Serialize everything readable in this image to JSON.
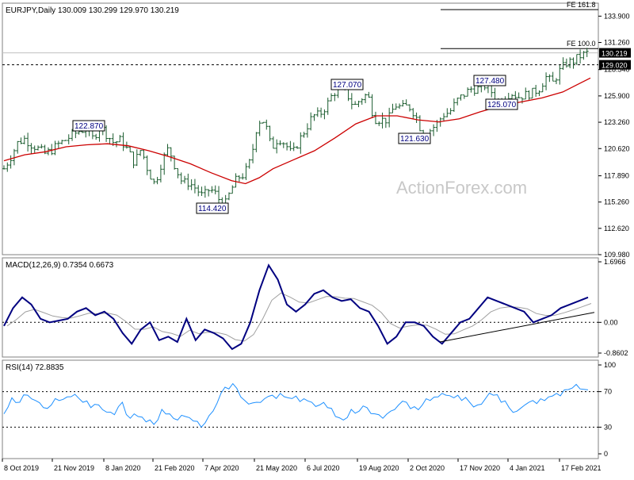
{
  "chart_data": [
    {
      "type": "candlestick",
      "title": "EURJPY,Daily  130.009 130.299 129.970 130.219",
      "ylim": [
        109.98,
        135.2
      ],
      "yticks": [
        "133.900",
        "131.260",
        "128.540",
        "125.900",
        "123.260",
        "120.620",
        "117.890",
        "115.260",
        "112.620",
        "109.980"
      ],
      "last_price": "130.219",
      "ref_level": "129.020",
      "fib_labels": [
        "FE 161.8",
        "FE 100.0"
      ],
      "fib_levels": [
        134.55,
        130.65
      ],
      "annotations": [
        "122.870",
        "114.420",
        "127.070",
        "121.630",
        "127.480",
        "125.070"
      ],
      "moving_average": "red",
      "watermark": "ActionForex.com",
      "price_path": [
        [
          0,
          118.6
        ],
        [
          2,
          119.8
        ],
        [
          4,
          121.2
        ],
        [
          6,
          121.6
        ],
        [
          8,
          121.0
        ],
        [
          10,
          120.6
        ],
        [
          12,
          120.1
        ],
        [
          14,
          120.5
        ],
        [
          16,
          121.1
        ],
        [
          18,
          121.5
        ],
        [
          20,
          122.0
        ],
        [
          22,
          122.4
        ],
        [
          24,
          122.6
        ],
        [
          26,
          121.6
        ],
        [
          28,
          122.9
        ],
        [
          30,
          122.0
        ],
        [
          32,
          121.2
        ],
        [
          34,
          121.5
        ],
        [
          36,
          120.5
        ],
        [
          38,
          119.2
        ],
        [
          40,
          120.6
        ],
        [
          42,
          118.4
        ],
        [
          44,
          117.0
        ],
        [
          46,
          119.3
        ],
        [
          48,
          120.7
        ],
        [
          50,
          118.7
        ],
        [
          52,
          117.2
        ],
        [
          54,
          117.2
        ],
        [
          56,
          116.6
        ],
        [
          58,
          115.8
        ],
        [
          60,
          116.6
        ],
        [
          62,
          116.0
        ],
        [
          64,
          114.6
        ],
        [
          66,
          116.3
        ],
        [
          68,
          117.7
        ],
        [
          70,
          118.0
        ],
        [
          72,
          119.5
        ],
        [
          74,
          123.4
        ],
        [
          76,
          123.4
        ],
        [
          78,
          120.6
        ],
        [
          80,
          121.7
        ],
        [
          82,
          121.1
        ],
        [
          84,
          120.0
        ],
        [
          86,
          121.4
        ],
        [
          88,
          122.6
        ],
        [
          90,
          123.9
        ],
        [
          92,
          124.0
        ],
        [
          94,
          124.9
        ],
        [
          96,
          126.2
        ],
        [
          98,
          126.6
        ],
        [
          100,
          126.1
        ],
        [
          102,
          124.8
        ],
        [
          104,
          125.6
        ],
        [
          106,
          126.1
        ],
        [
          108,
          123.6
        ],
        [
          110,
          123.5
        ],
        [
          112,
          123.5
        ],
        [
          114,
          125.0
        ],
        [
          116,
          124.7
        ],
        [
          118,
          124.9
        ],
        [
          120,
          124.0
        ],
        [
          122,
          122.1
        ],
        [
          124,
          122.4
        ],
        [
          126,
          123.0
        ],
        [
          128,
          124.0
        ],
        [
          130,
          124.3
        ],
        [
          132,
          125.4
        ],
        [
          134,
          126.0
        ],
        [
          136,
          126.6
        ],
        [
          138,
          126.6
        ],
        [
          140,
          127.0
        ],
        [
          142,
          126.4
        ],
        [
          144,
          125.3
        ],
        [
          146,
          125.9
        ],
        [
          148,
          126.2
        ],
        [
          150,
          125.8
        ],
        [
          152,
          126.0
        ],
        [
          154,
          126.2
        ],
        [
          156,
          126.6
        ],
        [
          158,
          127.8
        ],
        [
          160,
          127.2
        ],
        [
          162,
          128.4
        ],
        [
          164,
          129.2
        ],
        [
          166,
          129.4
        ],
        [
          168,
          129.9
        ],
        [
          170,
          130.2
        ]
      ],
      "ma_path": [
        [
          0,
          119.4
        ],
        [
          6,
          120.0
        ],
        [
          12,
          120.3
        ],
        [
          18,
          120.8
        ],
        [
          24,
          121.0
        ],
        [
          30,
          121.1
        ],
        [
          36,
          120.9
        ],
        [
          42,
          120.4
        ],
        [
          48,
          119.8
        ],
        [
          54,
          119.1
        ],
        [
          60,
          118.2
        ],
        [
          66,
          117.4
        ],
        [
          70,
          117.1
        ],
        [
          74,
          117.7
        ],
        [
          78,
          118.6
        ],
        [
          84,
          119.5
        ],
        [
          90,
          120.4
        ],
        [
          96,
          121.7
        ],
        [
          102,
          123.1
        ],
        [
          108,
          123.9
        ],
        [
          114,
          123.9
        ],
        [
          120,
          123.5
        ],
        [
          126,
          123.3
        ],
        [
          132,
          123.6
        ],
        [
          138,
          124.3
        ],
        [
          144,
          124.9
        ],
        [
          150,
          125.3
        ],
        [
          156,
          125.7
        ],
        [
          162,
          126.3
        ],
        [
          166,
          127.0
        ],
        [
          170,
          127.7
        ]
      ]
    },
    {
      "type": "line",
      "title": "MACD(12,26,9) 0.7354 0.6673",
      "ylim": [
        -0.8602,
        1.6966
      ],
      "yticks": [
        "1.6966",
        "0.00",
        "-0.8602"
      ],
      "series": [
        {
          "values": [
            -0.1,
            0.4,
            0.7,
            0.5,
            0.1,
            0.0,
            0.05,
            0.1,
            0.3,
            0.4,
            0.2,
            0.3,
            0.1,
            -0.3,
            -0.6,
            -0.2,
            0.0,
            -0.5,
            -0.4,
            -0.55,
            0.1,
            -0.5,
            -0.2,
            -0.3,
            -0.45,
            -0.75,
            -0.6,
            0.0,
            0.9,
            1.6,
            1.2,
            0.5,
            0.3,
            0.5,
            0.8,
            0.9,
            0.7,
            0.6,
            0.65,
            0.4,
            0.3,
            -0.1,
            -0.6,
            -0.4,
            0.0,
            0.0,
            -0.1,
            -0.4,
            -0.6,
            -0.3,
            0.0,
            0.1,
            0.4,
            0.7,
            0.6,
            0.5,
            0.4,
            0.3,
            0.0,
            0.1,
            0.2,
            0.4,
            0.5,
            0.6,
            0.7
          ]
        }
      ],
      "trendline": "black"
    },
    {
      "type": "line",
      "title": "RSI(14) 72.8835",
      "ylim": [
        0,
        100
      ],
      "yticks": [
        "100",
        "70",
        "30",
        "0"
      ],
      "series": [
        {
          "values": [
            45,
            63,
            58,
            66,
            60,
            52,
            55,
            60,
            64,
            67,
            58,
            52,
            55,
            47,
            44,
            58,
            40,
            42,
            36,
            33,
            50,
            45,
            38,
            42,
            37,
            30,
            43,
            57,
            75,
            79,
            64,
            56,
            58,
            62,
            66,
            68,
            63,
            65,
            62,
            58,
            55,
            52,
            42,
            38,
            50,
            48,
            52,
            45,
            40,
            48,
            55,
            58,
            53,
            55,
            60,
            64,
            66,
            63,
            60,
            58,
            55,
            62,
            66,
            58,
            52,
            48,
            55,
            60,
            62,
            64,
            68,
            72,
            74,
            73,
            72
          ]
        }
      ]
    }
  ],
  "x_axis": {
    "ticks": [
      "8 Oct 2019",
      "21 Nov 2019",
      "8 Jan 2020",
      "21 Feb 2020",
      "7 Apr 2020",
      "21 May 2020",
      "6 Jul 2020",
      "19 Aug 2020",
      "2 Oct 2020",
      "17 Nov 2020",
      "4 Jan 2021",
      "17 Feb 2021"
    ]
  }
}
